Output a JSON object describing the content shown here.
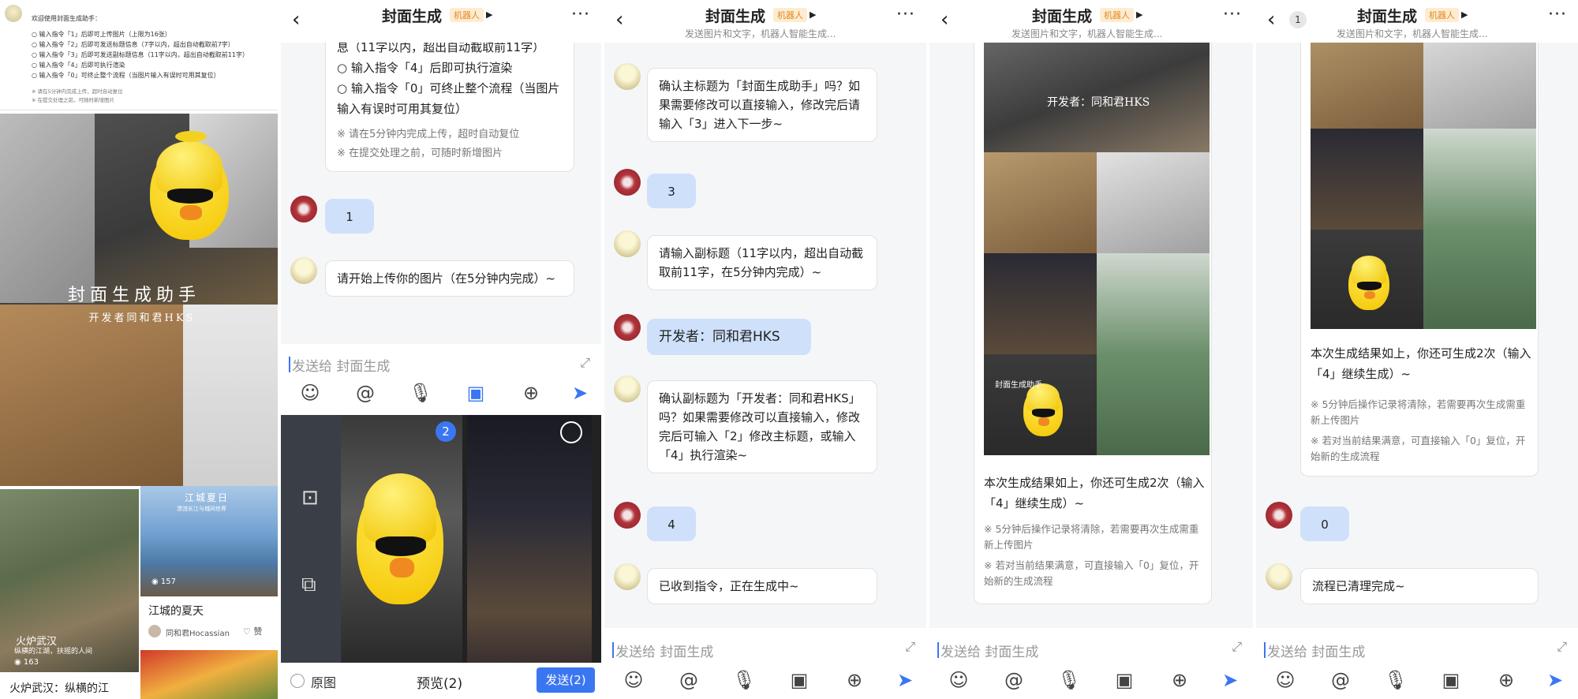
{
  "colors": {
    "accent": "#3b76f2",
    "bot_badge": "#e08a1e",
    "user_bubble": "#cfe0fb"
  },
  "panel1": {
    "guide_title": "欢迎使用封面生成助手：",
    "guide_lines": [
      "○ 输入指令「1」后即可上传图片（上限为16张）",
      "○ 输入指令「2」后即可发送标题信息（7字以内，超出自动截取前7字）",
      "○ 输入指令「3」后即可发送副标题信息（11字以内，超出自动截取前11字）",
      "○ 输入指令「4」后即可执行渲染",
      "○ 输入指令「0」可终止整个流程（当图片输入有误时可用其复位）"
    ],
    "guide_notes": [
      "※ 请在5分钟内完成上传，超时自动复位",
      "※ 在提交处理之前，可随时新增图片"
    ],
    "cover_title": "封面生成助手",
    "cover_sub": "开发者同和君HKS",
    "card1": {
      "title": "火炉武汉：纵横的江",
      "subtitle": "纵横的江湖，扶摇的人间",
      "views": "163",
      "overlay": "火炉武汉"
    },
    "card2": {
      "title": "江城的夏天",
      "overlay": "江城夏日",
      "overlay_sub": "漂流长江与城间世界",
      "views": "157",
      "author": "同和君Hocassian",
      "like": "赞"
    }
  },
  "chat": {
    "title": "封面生成",
    "badge": "机器人",
    "subtitle": "发送图片和文字，机器人智能生成...",
    "input_placeholder": "发送给 封面生成",
    "back_count": "1"
  },
  "panel2": {
    "msg_partial": "息（11字以内，超出自动截取前11字）",
    "msg_opt4": "○ 输入指令「4」后即可执行渲染",
    "msg_opt0": "○ 输入指令「0」可终止整个流程（当图片输入有误时可用其复位）",
    "note1": "※ 请在5分钟内完成上传，超时自动复位",
    "note2": "※ 在提交处理之前，可随时新增图片",
    "user1": "1",
    "bot2": "请开始上传你的图片（在5分钟内完成）~",
    "picker_badge": "2",
    "original_label": "原图",
    "preview_label": "预览(2)",
    "send_label": "发送(2)"
  },
  "panel3": {
    "bot1": "确认主标题为「封面生成助手」吗？如果需要修改可以直接输入，修改完后请输入「3」进入下一步~",
    "user1": "3",
    "bot2": "请输入副标题（11字以内，超出自动截取前11字，在5分钟内完成）~",
    "user2": "开发者：同和君HKS",
    "bot3": "确认副标题为「开发者：同和君HKS」吗？如果需要修改可以直接输入，修改完后可输入「2」修改主标题，或输入「4」执行渲染~",
    "user3": "4",
    "bot4": "已收到指令，正在生成中~"
  },
  "panel4": {
    "result": "本次生成结果如上，你还可生成2次（输入「4」继续生成）~",
    "note1": "※ 5分钟后操作记录将清除，若需要再次生成需重新上传图片",
    "note2": "※ 若对当前结果满意，可直接输入「0」复位，开始新的生成流程",
    "img_title": "封面生成助手",
    "img_sub": "开发者：同和君HKS"
  },
  "panel5": {
    "result": "本次生成结果如上，你还可生成2次（输入「4」继续生成）~",
    "note1": "※ 5分钟后操作记录将清除，若需要再次生成需重新上传图片",
    "note2": "※ 若对当前结果满意，可直接输入「0」复位，开始新的生成流程",
    "user1": "0",
    "bot1": "流程已清理完成~"
  }
}
